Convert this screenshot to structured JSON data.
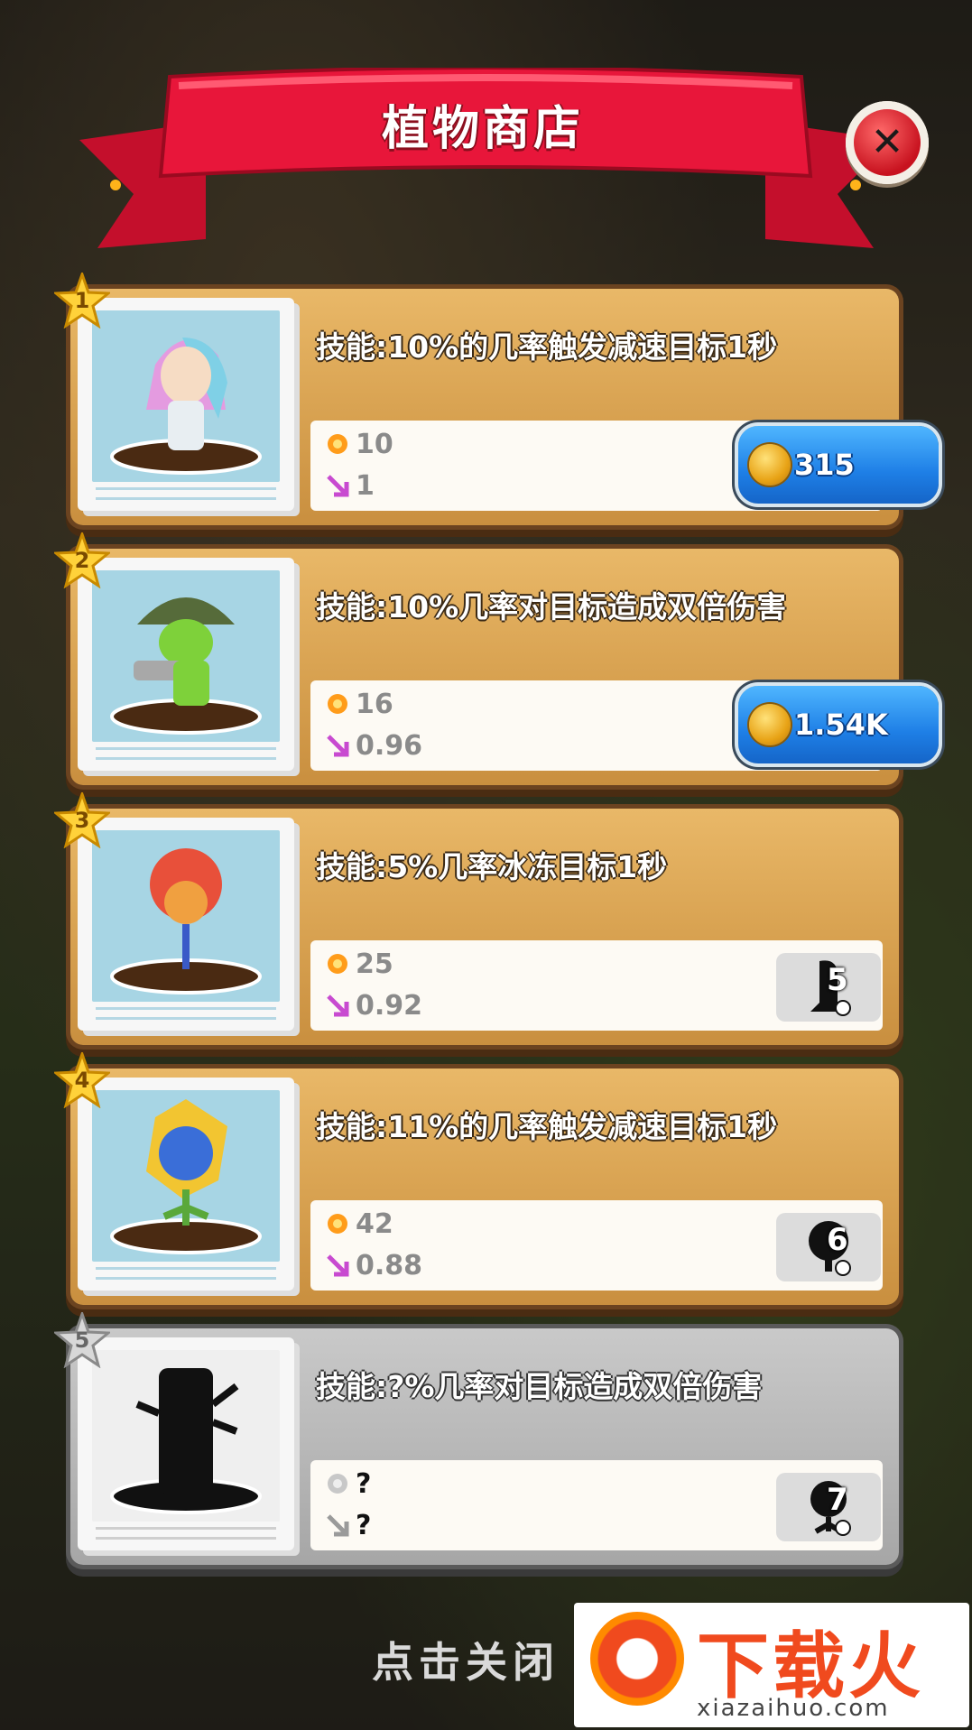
{
  "header": {
    "title": "植物商店",
    "close_icon": "close-icon"
  },
  "cards": [
    {
      "rank": "1",
      "skill": "技能:10%的几率触发减速目标1秒",
      "stat1": "10",
      "stat2": "1",
      "action": "buy",
      "price": "315"
    },
    {
      "rank": "2",
      "skill": "技能:10%几率对目标造成双倍伤害",
      "stat1": "16",
      "stat2": "0.96",
      "action": "buy",
      "price": "1.54K"
    },
    {
      "rank": "3",
      "skill": "技能:5%几率冰冻目标1秒",
      "stat1": "25",
      "stat2": "0.92",
      "action": "locked",
      "unlock_level": "5"
    },
    {
      "rank": "4",
      "skill": "技能:11%的几率触发减速目标1秒",
      "stat1": "42",
      "stat2": "0.88",
      "action": "locked",
      "unlock_level": "6"
    },
    {
      "rank": "5",
      "skill": "技能:?%几率对目标造成双倍伤害",
      "stat1": "?",
      "stat2": "?",
      "action": "locked",
      "unlock_level": "7"
    }
  ],
  "footer": {
    "tap_to_close": "点击关闭"
  },
  "watermark": {
    "brand": "下载火",
    "url": "xiazaihuo.com"
  },
  "colors": {
    "ribbon": "#e8163a",
    "card_wood": "#d9a352",
    "buy_button": "#1e7fe6",
    "locked_card": "#b8b8b8"
  }
}
